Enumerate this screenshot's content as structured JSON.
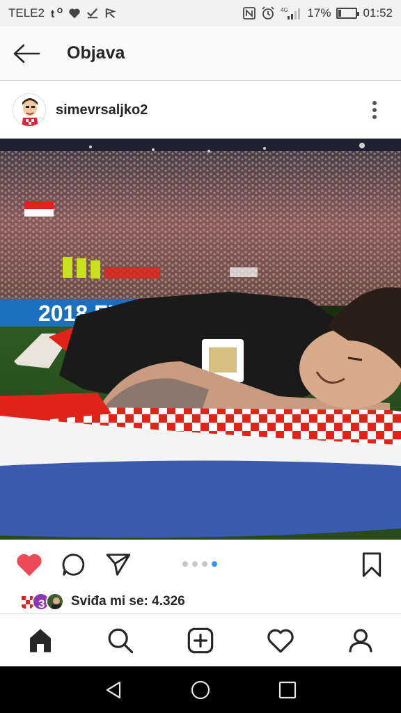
{
  "status_bar": {
    "carrier": "TELE2",
    "network": "4G",
    "battery": "17%",
    "battery_level": 0.17,
    "time": "01:52",
    "icons": [
      "nfc-icon",
      "alarm-icon",
      "signal-icon",
      "battery-icon",
      "heart-icon",
      "check-icon",
      "flag-icon"
    ]
  },
  "header": {
    "title": "Objava"
  },
  "post": {
    "username": "simevrsaljko2",
    "carousel": {
      "count": 4,
      "active_index": 3
    },
    "likes_text": "Sviđa mi se: 4.326",
    "liked": true
  },
  "colors": {
    "like_red": "#ed4956",
    "accent_blue": "#3897f0",
    "flag_red": "#e2231a",
    "flag_blue": "#3a5bb0"
  },
  "bottom_nav": [
    "home-icon",
    "search-icon",
    "add-post-icon",
    "activity-icon",
    "profile-icon"
  ]
}
